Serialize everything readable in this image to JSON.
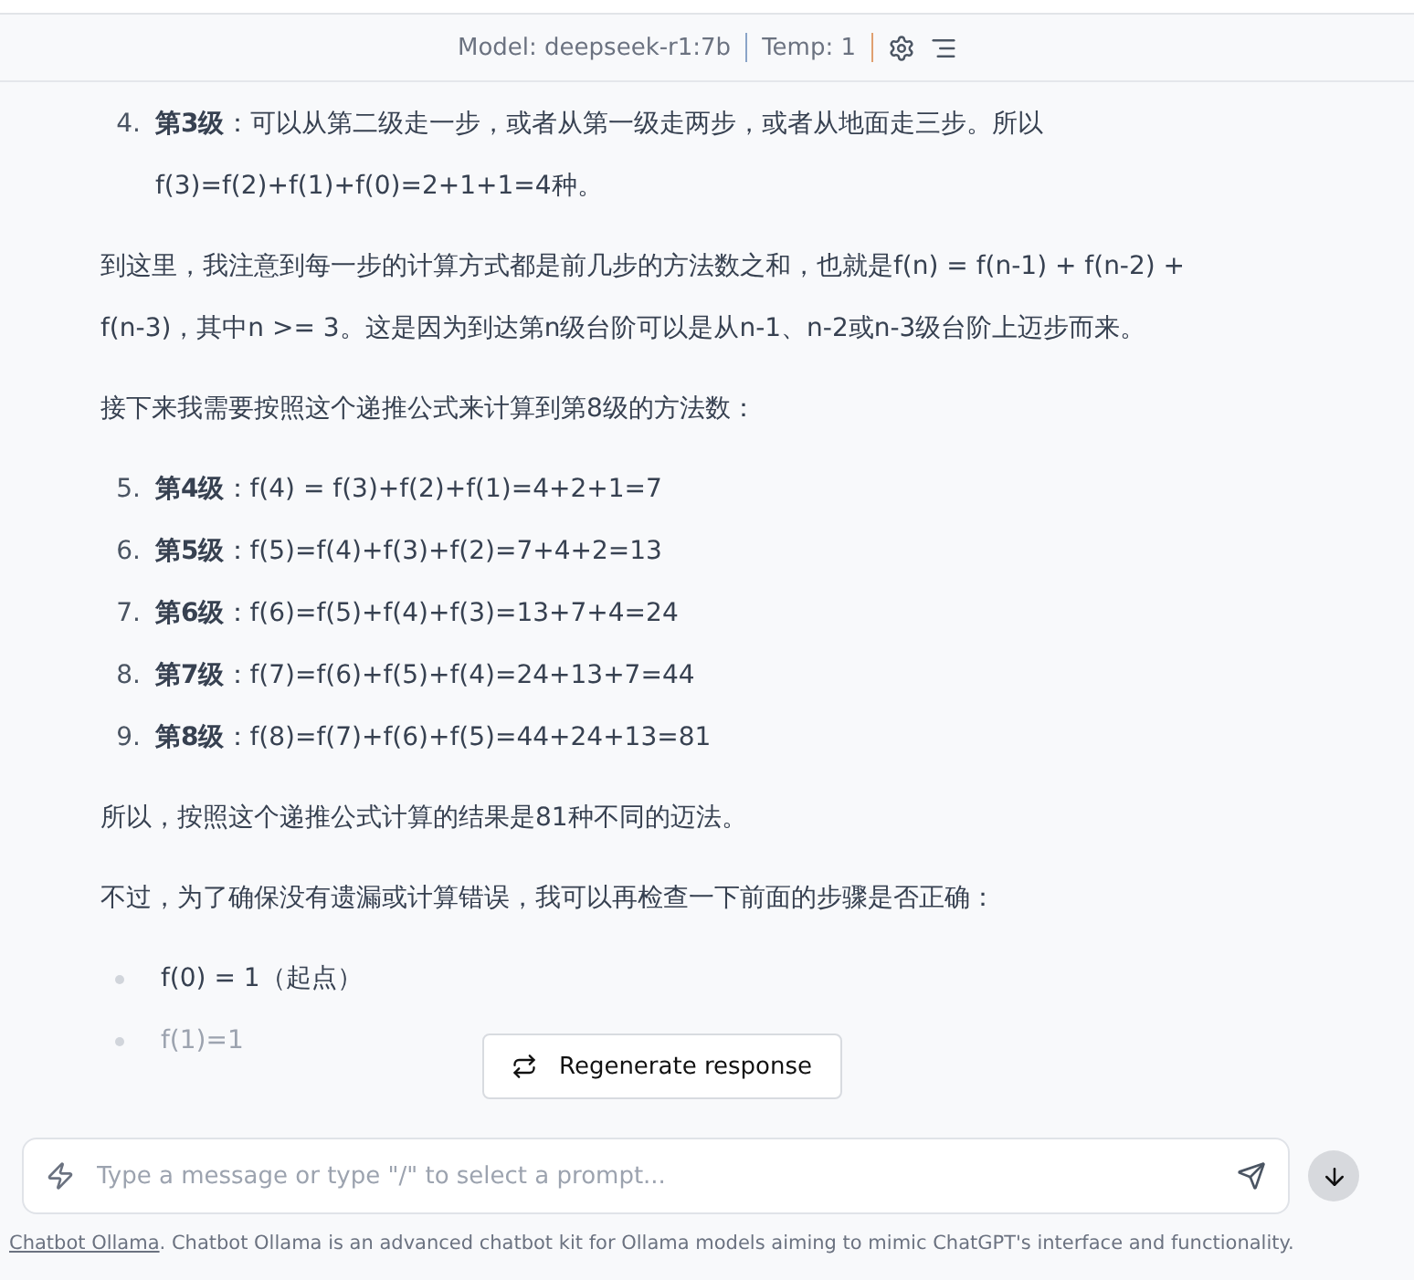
{
  "header": {
    "model": "Model: deepseek-r1:7b",
    "temp": "Temp: 1"
  },
  "content": [
    {
      "kind": "ol",
      "items": [
        {
          "number": "4.",
          "text": "**第3级**：可以从第二级走一步，或者从第一级走两步，或者从地面走三步。所以f(3)=f(2)+f(1)+f(0)=2+1+1=4种。"
        }
      ]
    },
    {
      "kind": "p",
      "text": "到这里，我注意到每一步的计算方式都是前几步的方法数之和，也就是f(n) = f(n-1) + f(n-2) + f(n-3)，其中n >= 3。这是因为到达第n级台阶可以是从n-1、n-2或n-3级台阶上迈步而来。"
    },
    {
      "kind": "p",
      "text": "接下来我需要按照这个递推公式来计算到第8级的方法数："
    },
    {
      "kind": "ol",
      "items": [
        {
          "number": "5.",
          "text": "**第4级**：f(4) = f(3)+f(2)+f(1)=4+2+1=7"
        },
        {
          "number": "6.",
          "text": "**第5级**：f(5)=f(4)+f(3)+f(2)=7+4+2=13"
        },
        {
          "number": "7.",
          "text": "**第6级**：f(6)=f(5)+f(4)+f(3)=13+7+4=24"
        },
        {
          "number": "8.",
          "text": "**第7级**：f(7)=f(6)+f(5)+f(4)=24+13+7=44"
        },
        {
          "number": "9.",
          "text": "**第8级**：f(8)=f(7)+f(6)+f(5)=44+24+13=81"
        }
      ]
    },
    {
      "kind": "p",
      "text": "所以，按照这个递推公式计算的结果是81种不同的迈法。"
    },
    {
      "kind": "p",
      "text": "不过，为了确保没有遗漏或计算错误，我可以再检查一下前面的步骤是否正确："
    },
    {
      "kind": "ul",
      "items": [
        {
          "text": "f(0) = 1（起点）",
          "faded": false
        },
        {
          "text": "f(1)=1",
          "faded": true
        }
      ]
    }
  ],
  "regenerate": "Regenerate response",
  "input": {
    "placeholder": "Type a message or type \"/\" to select a prompt..."
  },
  "footer": {
    "link": "Chatbot Ollama",
    "text": ". Chatbot Ollama is an advanced chatbot kit for Ollama models aiming to mimic ChatGPT's interface and functionality."
  }
}
